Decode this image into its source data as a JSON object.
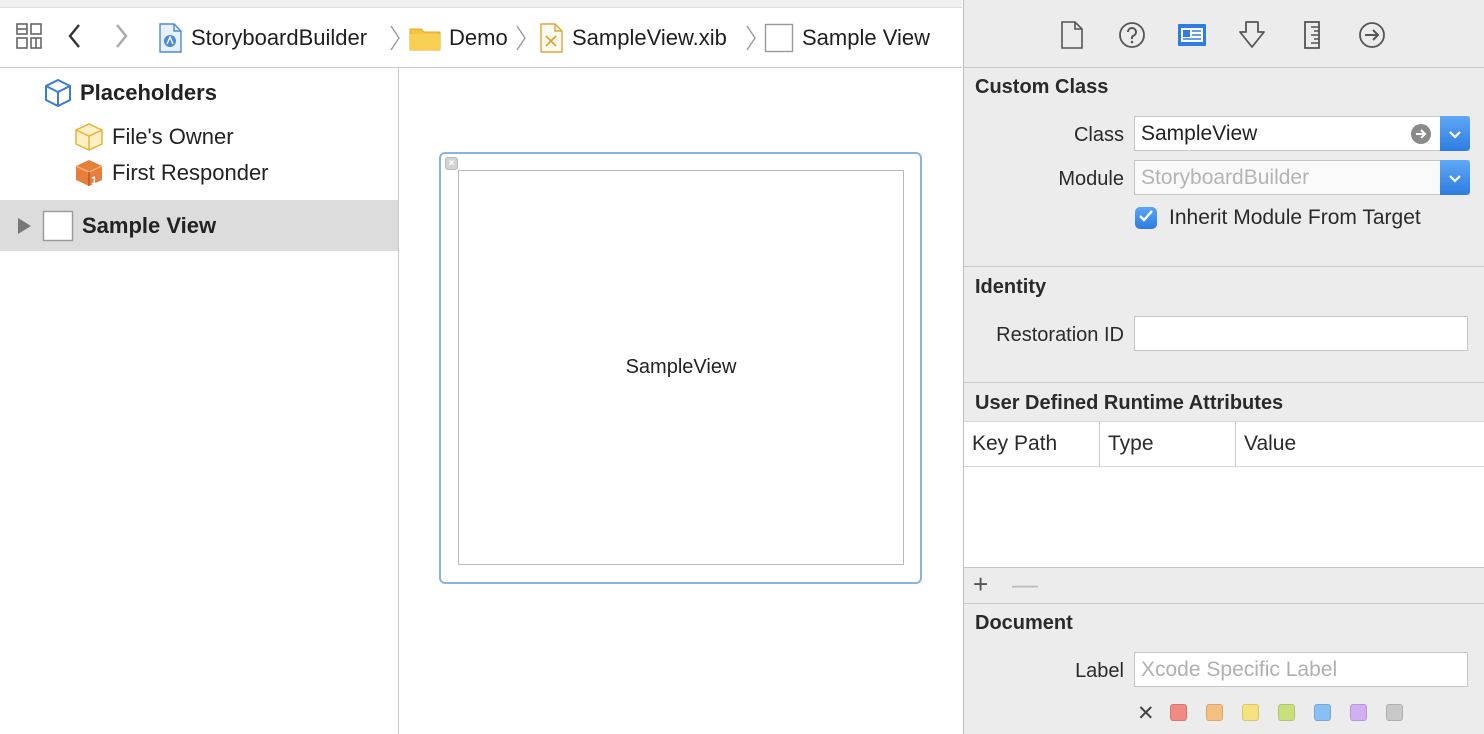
{
  "jumpbar": {
    "crumbs": [
      {
        "label": "StoryboardBuilder",
        "icon": "xcode-project-icon"
      },
      {
        "label": "Demo",
        "icon": "folder-icon"
      },
      {
        "label": "SampleView.xib",
        "icon": "xib-file-icon"
      },
      {
        "label": "Sample View",
        "icon": "view-icon"
      }
    ]
  },
  "outline": {
    "placeholders_label": "Placeholders",
    "files_owner_label": "File's Owner",
    "first_responder_label": "First Responder",
    "sample_view_label": "Sample View"
  },
  "canvas": {
    "view_label": "SampleView"
  },
  "inspector": {
    "tabs": [
      "file-inspector-icon",
      "quick-help-icon",
      "identity-inspector-icon",
      "attributes-inspector-icon",
      "size-inspector-icon",
      "connections-inspector-icon"
    ],
    "custom_class": {
      "title": "Custom Class",
      "class_label": "Class",
      "class_value": "SampleView",
      "module_label": "Module",
      "module_placeholder": "StoryboardBuilder",
      "inherit_label": "Inherit Module From Target",
      "inherit_checked": true
    },
    "identity": {
      "title": "Identity",
      "restoration_label": "Restoration ID",
      "restoration_value": ""
    },
    "runtime_attributes": {
      "title": "User Defined Runtime Attributes",
      "columns": [
        "Key Path",
        "Type",
        "Value"
      ],
      "add_symbol": "+",
      "remove_symbol": "—"
    },
    "document": {
      "title": "Document",
      "label_label": "Label",
      "label_placeholder": "Xcode Specific Label",
      "clear_symbol": "✕",
      "colors": [
        "#f08a82",
        "#f5c07f",
        "#f4e27c",
        "#c8e07c",
        "#88c0f5",
        "#d3aef0",
        "#c8c8c8"
      ]
    }
  }
}
